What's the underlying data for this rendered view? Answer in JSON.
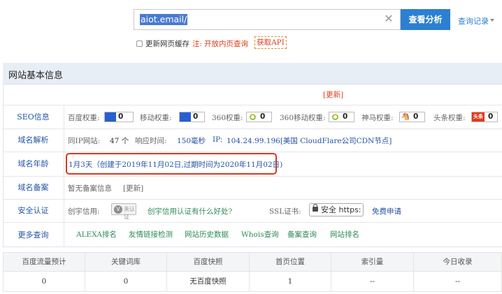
{
  "search": {
    "value": "aiot.email/",
    "clear_icon": "close-icon",
    "analyze_label": "查看分析",
    "history_label": "查询记录"
  },
  "refresh": {
    "label": "更新网页缓存",
    "note_prefix": "注:",
    "note_text": "开放内页查询",
    "api_label": "获取API"
  },
  "panel": {
    "title": "网站基本信息",
    "update_label": "[更新]"
  },
  "seo": {
    "label": "SEO信息",
    "items": [
      {
        "name": "百度权重:",
        "icon": "paw-icon",
        "value": "0"
      },
      {
        "name": "移动权重:",
        "icon": "paw-icon",
        "value": "0"
      },
      {
        "name": "360权重:",
        "icon": "360-icon",
        "value": "0"
      },
      {
        "name": "360移动权重:",
        "icon": "360-icon",
        "value": "0"
      },
      {
        "name": "神马权重:",
        "icon": "shenma-icon",
        "value": "0"
      },
      {
        "name": "头条权重:",
        "icon": "toutiao-icon",
        "value": "0",
        "icon_text": "头条"
      }
    ]
  },
  "domain": {
    "label": "域名解析",
    "same_ip_label": "同IP网站:",
    "same_ip_value": "47 个",
    "response_label": "响应时间:",
    "response_value": "150毫秒",
    "ip_label": "IP:",
    "ip_value": "104.24.99.196[美国 CloudFlare公司CDN节点]"
  },
  "age": {
    "label": "域名年龄",
    "value": "1月3天（创建于2019年11月02日,过期时间为2020年11月02日)"
  },
  "icp": {
    "label": "域名备案",
    "value": "暂无备案信息",
    "update_label": "[更新]"
  },
  "security": {
    "label": "安全认证",
    "credit_label": "创宇信用:",
    "cert_text": "未认证",
    "credit_link": "创宇信用认证有什么好处?",
    "ssl_label": "SSL证书:",
    "https_text": "安全 https:",
    "apply_link": "免费申请"
  },
  "more": {
    "label": "更多查询",
    "links": [
      "ALEXA排名",
      "友情链接检测",
      "网站历史数据",
      "Whois查询",
      "备案查询",
      "网站排名"
    ]
  },
  "stats": {
    "headers": [
      "百度流量预计",
      "关键词库",
      "百度快照",
      "首页位置",
      "索引量",
      "今日收录"
    ],
    "values": [
      "0",
      "0",
      "无百度快照",
      "1",
      "--",
      "--"
    ]
  },
  "colors": {
    "accent": "#2d7fd1",
    "link": "#2453a4",
    "warn": "#e23a1a",
    "highlight_border": "#d9381e"
  }
}
